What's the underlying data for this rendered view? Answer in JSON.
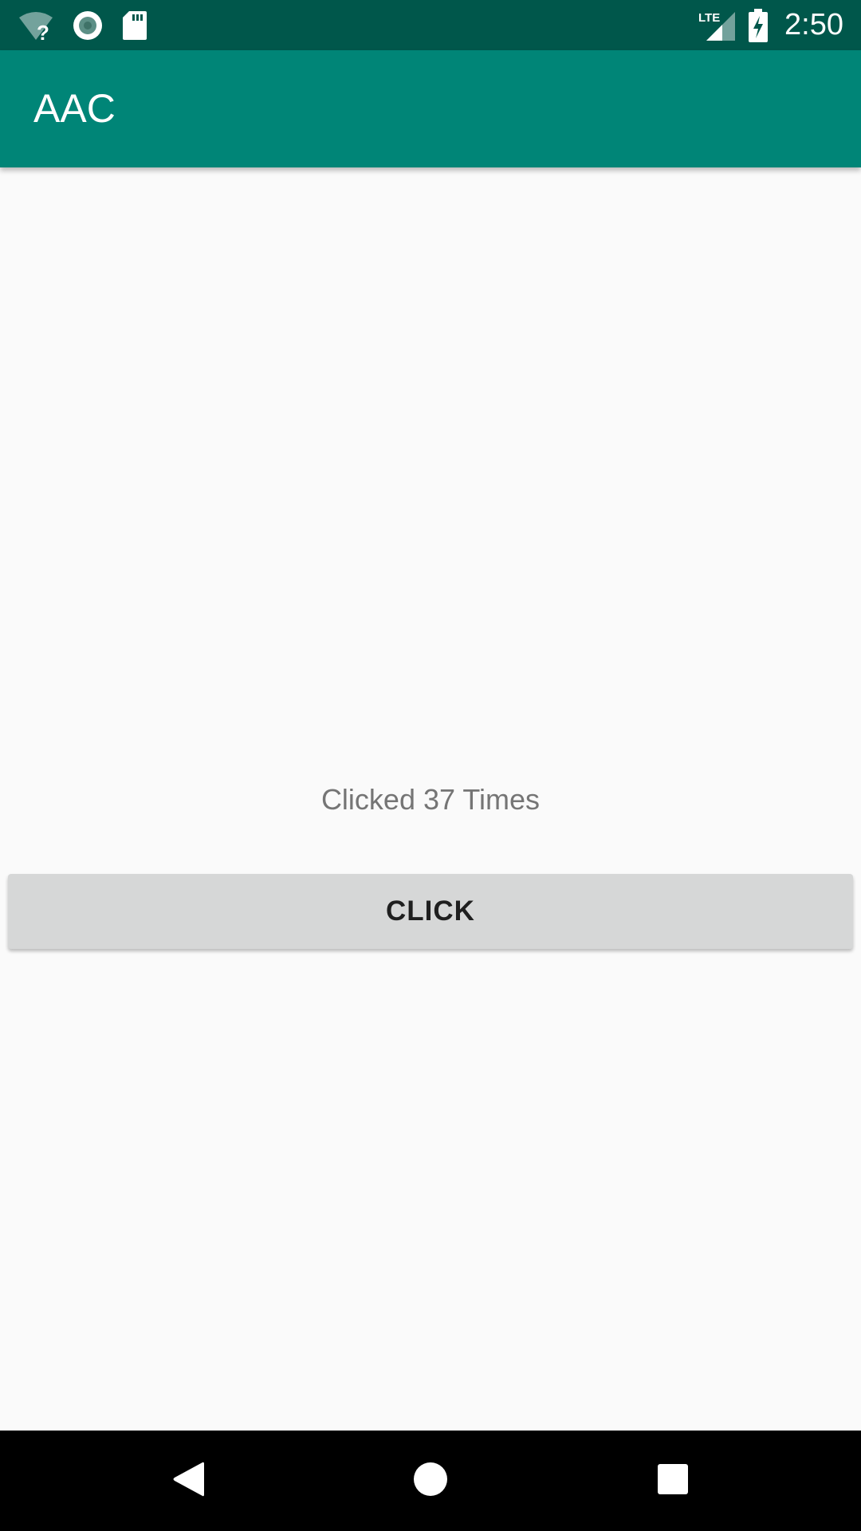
{
  "status_bar": {
    "time": "2:50",
    "network_label": "LTE",
    "icons": [
      "wifi-unknown-icon",
      "sync-icon",
      "sd-card-icon",
      "lte-signal-icon",
      "battery-charging-icon"
    ],
    "background": "#00574b"
  },
  "app_bar": {
    "title": "AAC",
    "background": "#008577"
  },
  "main": {
    "click_count_text": "Clicked 37 Times",
    "button_label": "CLICK"
  },
  "nav_bar": {
    "buttons": [
      "back-icon",
      "home-icon",
      "recents-icon"
    ]
  }
}
